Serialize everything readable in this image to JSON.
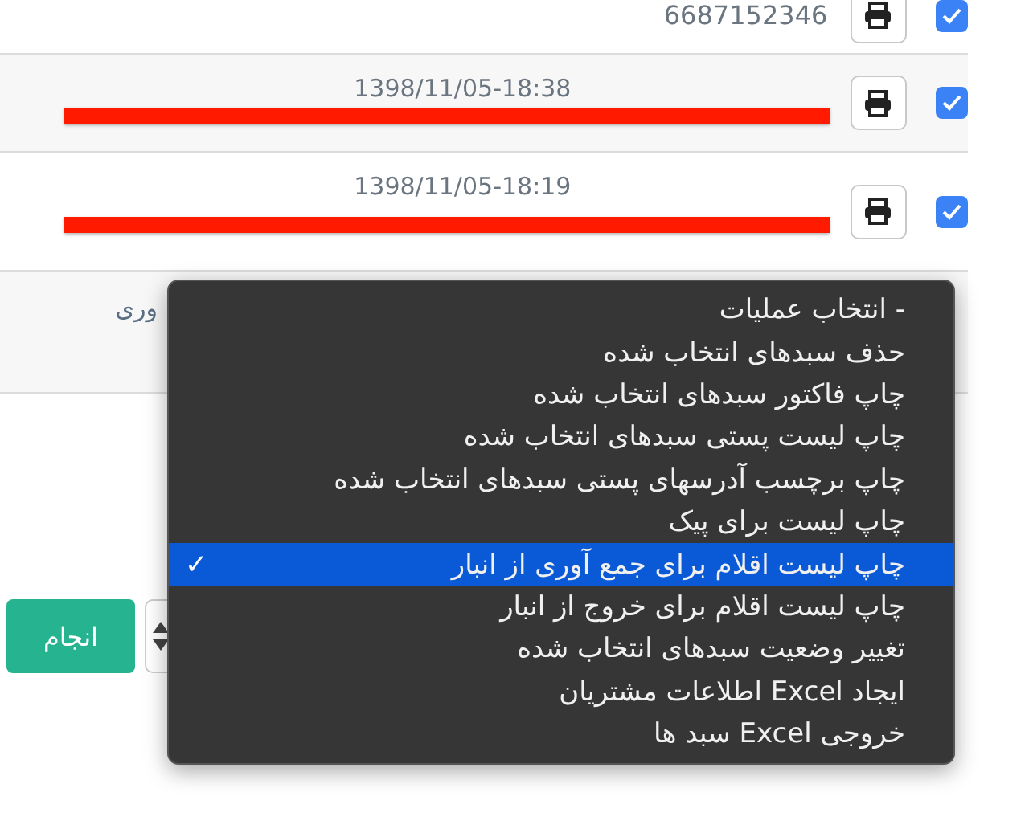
{
  "table": {
    "rows": [
      {
        "kind": "order",
        "phone": "6687152346",
        "checked": true,
        "redacted": false
      },
      {
        "kind": "order",
        "date": "1398/11/05-18:38",
        "checked": true,
        "redacted": true
      },
      {
        "kind": "order",
        "date": "1398/11/05-18:19",
        "checked": true,
        "redacted": true
      },
      {
        "kind": "summary",
        "name": "وری"
      }
    ]
  },
  "actions": {
    "submit": "انجام",
    "menu": {
      "check_mark": "✓",
      "items": [
        {
          "label": "- انتخاب عملیات",
          "selected": false
        },
        {
          "label": "حذف سبدهای انتخاب شده",
          "selected": false
        },
        {
          "label": "چاپ فاکتور سبدهای انتخاب شده",
          "selected": false
        },
        {
          "label": "چاپ لیست پستی سبدهای انتخاب شده",
          "selected": false
        },
        {
          "label": "چاپ برچسب آدرسهای پستی سبدهای انتخاب شده",
          "selected": false
        },
        {
          "label": "چاپ لیست برای پیک",
          "selected": false
        },
        {
          "label": "چاپ لیست اقلام برای جمع آوری از انبار",
          "selected": true
        },
        {
          "label": "چاپ لیست اقلام برای خروج از انبار",
          "selected": false
        },
        {
          "label": "تغییر وضعیت سبدهای انتخاب شده",
          "selected": false
        },
        {
          "label": "ایجاد Excel اطلاعات مشتریان",
          "selected": false
        },
        {
          "label": "خروجی Excel سبد ها",
          "selected": false
        }
      ]
    }
  }
}
